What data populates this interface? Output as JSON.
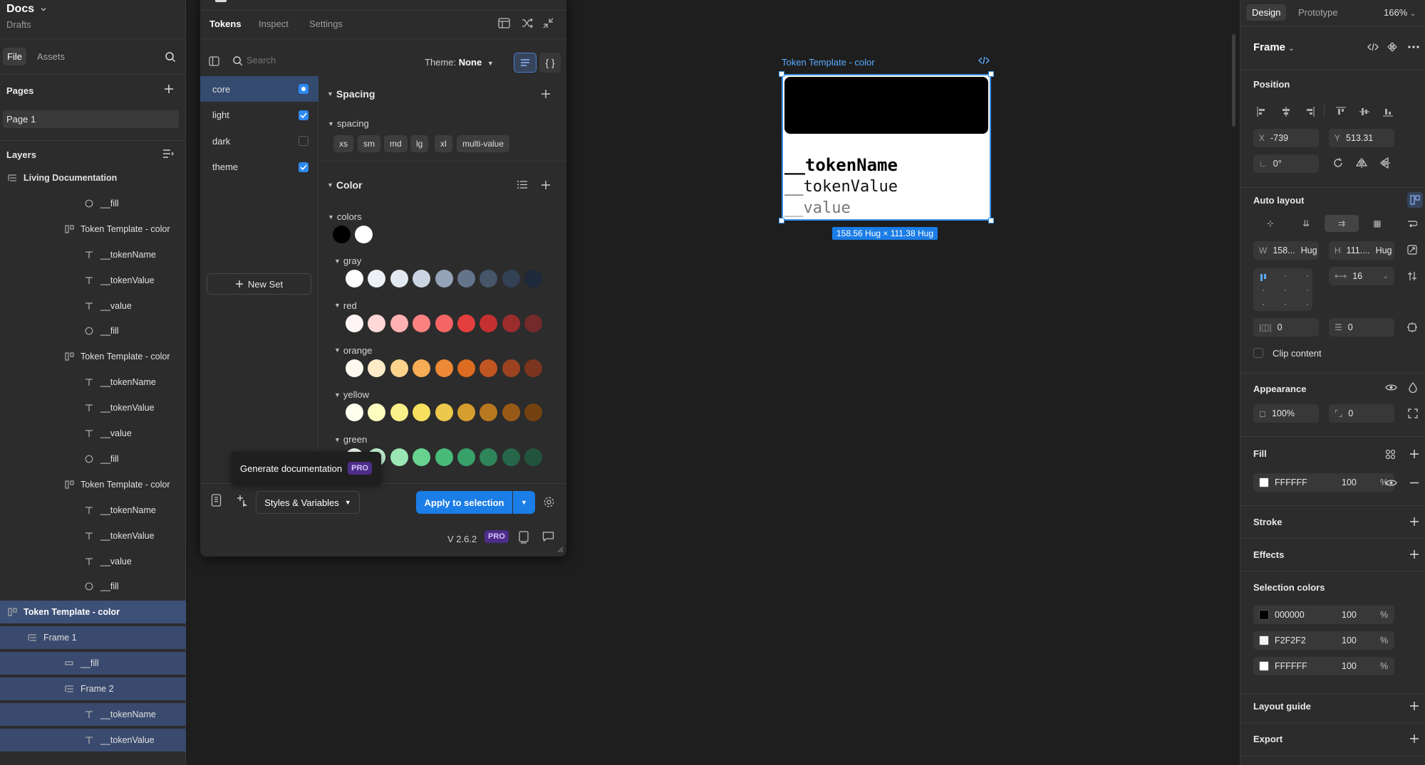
{
  "app": {
    "title": "Docs",
    "subtitle": "Drafts"
  },
  "left": {
    "tabs": {
      "file": "File",
      "assets": "Assets"
    },
    "pages_label": "Pages",
    "pages": [
      "Page 1"
    ],
    "layers_label": "Layers",
    "layers": [
      {
        "name": "Living Documentation",
        "icon": "frame-stack-icon",
        "indent": 0
      },
      {
        "name": "__fill",
        "icon": "ellipse-icon",
        "indent": 3
      },
      {
        "name": "Token Template - color",
        "icon": "auto-layout-icon",
        "indent": 2
      },
      {
        "name": "__tokenName",
        "icon": "text-icon",
        "indent": 3
      },
      {
        "name": "__tokenValue",
        "icon": "text-icon",
        "indent": 3
      },
      {
        "name": "__value",
        "icon": "text-icon",
        "indent": 3
      },
      {
        "name": "__fill",
        "icon": "ellipse-icon",
        "indent": 3
      },
      {
        "name": "Token Template - color",
        "icon": "auto-layout-icon",
        "indent": 2
      },
      {
        "name": "__tokenName",
        "icon": "text-icon",
        "indent": 3
      },
      {
        "name": "__tokenValue",
        "icon": "text-icon",
        "indent": 3
      },
      {
        "name": "__value",
        "icon": "text-icon",
        "indent": 3
      },
      {
        "name": "__fill",
        "icon": "ellipse-icon",
        "indent": 3
      },
      {
        "name": "Token Template - color",
        "icon": "auto-layout-icon",
        "indent": 2
      },
      {
        "name": "__tokenName",
        "icon": "text-icon",
        "indent": 3
      },
      {
        "name": "__tokenValue",
        "icon": "text-icon",
        "indent": 3
      },
      {
        "name": "__value",
        "icon": "text-icon",
        "indent": 3
      },
      {
        "name": "__fill",
        "icon": "ellipse-icon",
        "indent": 3
      },
      {
        "name": "Token Template - color",
        "icon": "auto-layout-icon",
        "indent": 0,
        "selected": "strong"
      },
      {
        "name": "Frame 1",
        "icon": "frame-stack-icon",
        "indent": 1,
        "selected": "child"
      },
      {
        "name": "__fill",
        "icon": "rect-icon",
        "indent": 2,
        "selected": "child"
      },
      {
        "name": "Frame 2",
        "icon": "frame-stack-icon",
        "indent": 2,
        "selected": "child"
      },
      {
        "name": "__tokenName",
        "icon": "text-icon",
        "indent": 3,
        "selected": "child"
      },
      {
        "name": "__tokenValue",
        "icon": "text-icon",
        "indent": 3,
        "selected": "child"
      }
    ]
  },
  "plugin": {
    "tabs": [
      "Tokens",
      "Inspect",
      "Settings"
    ],
    "search_placeholder": "Search",
    "theme_label": "Theme:",
    "theme_value": "None",
    "sets": [
      {
        "name": "core",
        "state": "active"
      },
      {
        "name": "light",
        "state": "on"
      },
      {
        "name": "dark",
        "state": "off"
      },
      {
        "name": "theme",
        "state": "on"
      }
    ],
    "new_set": "New Set",
    "spacing_group": "Spacing",
    "spacing_sub": "spacing",
    "spacing_tokens": [
      "xs",
      "sm",
      "md",
      "lg",
      "xl",
      "multi-value"
    ],
    "color_group": "Color",
    "color_groups": [
      {
        "name": "colors",
        "swatches": [
          "#000000",
          "#ffffff"
        ]
      },
      {
        "name": "gray",
        "swatches": [
          "#ffffff",
          "#eef1f5",
          "#e2e8f0",
          "#cbd5e1",
          "#94a3b8",
          "#64748b",
          "#475569",
          "#334155",
          "#1e293b"
        ]
      },
      {
        "name": "red",
        "swatches": [
          "#fff5f5",
          "#fed7d7",
          "#feb2b2",
          "#fc8181",
          "#f56565",
          "#e53e3e",
          "#c53030",
          "#9b2c2c",
          "#742a2a"
        ]
      },
      {
        "name": "orange",
        "swatches": [
          "#fffaf0",
          "#feebc8",
          "#fbd38d",
          "#f6ad55",
          "#ed8936",
          "#dd6b20",
          "#c05621",
          "#9c4221",
          "#7b341e"
        ]
      },
      {
        "name": "yellow",
        "swatches": [
          "#fffff0",
          "#fefcbf",
          "#faf089",
          "#f6e05e",
          "#ecc94b",
          "#d69e2e",
          "#b7791f",
          "#975a16",
          "#744210"
        ]
      },
      {
        "name": "green",
        "swatches": [
          "#f0fff4",
          "#c6f6d5",
          "#9ae6b4",
          "#68d391",
          "#48bb78",
          "#38a169",
          "#2f855a",
          "#276749",
          "#22543d"
        ]
      }
    ],
    "tooltip": "Generate documentation",
    "pro_badge": "PRO",
    "styles_button": "Styles & Variables",
    "apply_button": "Apply to selection",
    "version": "V 2.6.2"
  },
  "canvas": {
    "frame_label": "Token Template - color",
    "token_name": "__tokenName",
    "token_value": "__tokenValue",
    "value": "__value",
    "size_badge": "158.56 Hug × 111.38 Hug"
  },
  "right": {
    "tabs": {
      "design": "Design",
      "prototype": "Prototype"
    },
    "zoom": "166%",
    "frame_name": "Frame",
    "position_label": "Position",
    "x_label": "X",
    "x_value": "-739",
    "y_label": "Y",
    "y_value": "513.31",
    "rotation": "0°",
    "auto_layout_label": "Auto layout",
    "w_label": "W",
    "w_value": "158...",
    "w_mode": "Hug",
    "h_label": "H",
    "h_value": "111....",
    "h_mode": "Hug",
    "gap_value": "16",
    "padding_h": "0",
    "padding_v": "0",
    "clip_content": "Clip content",
    "appearance_label": "Appearance",
    "opacity": "100%",
    "radius": "0",
    "fill_label": "Fill",
    "fill": {
      "hex": "FFFFFF",
      "opacity": "100",
      "pct": "%",
      "color": "#ffffff"
    },
    "stroke_label": "Stroke",
    "effects_label": "Effects",
    "selection_colors_label": "Selection colors",
    "selection_colors": [
      {
        "hex": "000000",
        "opacity": "100",
        "pct": "%",
        "color": "#000000"
      },
      {
        "hex": "F2F2F2",
        "opacity": "100",
        "pct": "%",
        "color": "#f2f2f2"
      },
      {
        "hex": "FFFFFF",
        "opacity": "100",
        "pct": "%",
        "color": "#ffffff"
      }
    ],
    "layout_guide_label": "Layout guide",
    "export_label": "Export"
  }
}
